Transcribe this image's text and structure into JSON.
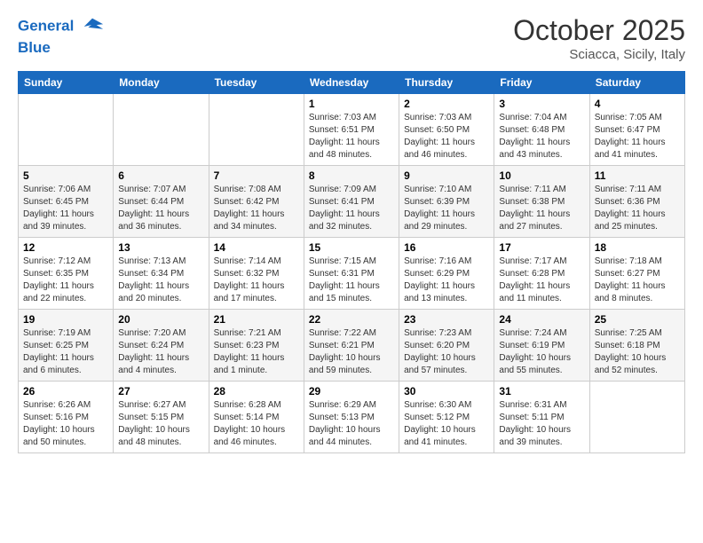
{
  "header": {
    "logo_line1": "General",
    "logo_line2": "Blue",
    "month_title": "October 2025",
    "location": "Sciacca, Sicily, Italy"
  },
  "days_of_week": [
    "Sunday",
    "Monday",
    "Tuesday",
    "Wednesday",
    "Thursday",
    "Friday",
    "Saturday"
  ],
  "weeks": [
    [
      {
        "day": "",
        "info": ""
      },
      {
        "day": "",
        "info": ""
      },
      {
        "day": "",
        "info": ""
      },
      {
        "day": "1",
        "info": "Sunrise: 7:03 AM\nSunset: 6:51 PM\nDaylight: 11 hours\nand 48 minutes."
      },
      {
        "day": "2",
        "info": "Sunrise: 7:03 AM\nSunset: 6:50 PM\nDaylight: 11 hours\nand 46 minutes."
      },
      {
        "day": "3",
        "info": "Sunrise: 7:04 AM\nSunset: 6:48 PM\nDaylight: 11 hours\nand 43 minutes."
      },
      {
        "day": "4",
        "info": "Sunrise: 7:05 AM\nSunset: 6:47 PM\nDaylight: 11 hours\nand 41 minutes."
      }
    ],
    [
      {
        "day": "5",
        "info": "Sunrise: 7:06 AM\nSunset: 6:45 PM\nDaylight: 11 hours\nand 39 minutes."
      },
      {
        "day": "6",
        "info": "Sunrise: 7:07 AM\nSunset: 6:44 PM\nDaylight: 11 hours\nand 36 minutes."
      },
      {
        "day": "7",
        "info": "Sunrise: 7:08 AM\nSunset: 6:42 PM\nDaylight: 11 hours\nand 34 minutes."
      },
      {
        "day": "8",
        "info": "Sunrise: 7:09 AM\nSunset: 6:41 PM\nDaylight: 11 hours\nand 32 minutes."
      },
      {
        "day": "9",
        "info": "Sunrise: 7:10 AM\nSunset: 6:39 PM\nDaylight: 11 hours\nand 29 minutes."
      },
      {
        "day": "10",
        "info": "Sunrise: 7:11 AM\nSunset: 6:38 PM\nDaylight: 11 hours\nand 27 minutes."
      },
      {
        "day": "11",
        "info": "Sunrise: 7:11 AM\nSunset: 6:36 PM\nDaylight: 11 hours\nand 25 minutes."
      }
    ],
    [
      {
        "day": "12",
        "info": "Sunrise: 7:12 AM\nSunset: 6:35 PM\nDaylight: 11 hours\nand 22 minutes."
      },
      {
        "day": "13",
        "info": "Sunrise: 7:13 AM\nSunset: 6:34 PM\nDaylight: 11 hours\nand 20 minutes."
      },
      {
        "day": "14",
        "info": "Sunrise: 7:14 AM\nSunset: 6:32 PM\nDaylight: 11 hours\nand 17 minutes."
      },
      {
        "day": "15",
        "info": "Sunrise: 7:15 AM\nSunset: 6:31 PM\nDaylight: 11 hours\nand 15 minutes."
      },
      {
        "day": "16",
        "info": "Sunrise: 7:16 AM\nSunset: 6:29 PM\nDaylight: 11 hours\nand 13 minutes."
      },
      {
        "day": "17",
        "info": "Sunrise: 7:17 AM\nSunset: 6:28 PM\nDaylight: 11 hours\nand 11 minutes."
      },
      {
        "day": "18",
        "info": "Sunrise: 7:18 AM\nSunset: 6:27 PM\nDaylight: 11 hours\nand 8 minutes."
      }
    ],
    [
      {
        "day": "19",
        "info": "Sunrise: 7:19 AM\nSunset: 6:25 PM\nDaylight: 11 hours\nand 6 minutes."
      },
      {
        "day": "20",
        "info": "Sunrise: 7:20 AM\nSunset: 6:24 PM\nDaylight: 11 hours\nand 4 minutes."
      },
      {
        "day": "21",
        "info": "Sunrise: 7:21 AM\nSunset: 6:23 PM\nDaylight: 11 hours\nand 1 minute."
      },
      {
        "day": "22",
        "info": "Sunrise: 7:22 AM\nSunset: 6:21 PM\nDaylight: 10 hours\nand 59 minutes."
      },
      {
        "day": "23",
        "info": "Sunrise: 7:23 AM\nSunset: 6:20 PM\nDaylight: 10 hours\nand 57 minutes."
      },
      {
        "day": "24",
        "info": "Sunrise: 7:24 AM\nSunset: 6:19 PM\nDaylight: 10 hours\nand 55 minutes."
      },
      {
        "day": "25",
        "info": "Sunrise: 7:25 AM\nSunset: 6:18 PM\nDaylight: 10 hours\nand 52 minutes."
      }
    ],
    [
      {
        "day": "26",
        "info": "Sunrise: 6:26 AM\nSunset: 5:16 PM\nDaylight: 10 hours\nand 50 minutes."
      },
      {
        "day": "27",
        "info": "Sunrise: 6:27 AM\nSunset: 5:15 PM\nDaylight: 10 hours\nand 48 minutes."
      },
      {
        "day": "28",
        "info": "Sunrise: 6:28 AM\nSunset: 5:14 PM\nDaylight: 10 hours\nand 46 minutes."
      },
      {
        "day": "29",
        "info": "Sunrise: 6:29 AM\nSunset: 5:13 PM\nDaylight: 10 hours\nand 44 minutes."
      },
      {
        "day": "30",
        "info": "Sunrise: 6:30 AM\nSunset: 5:12 PM\nDaylight: 10 hours\nand 41 minutes."
      },
      {
        "day": "31",
        "info": "Sunrise: 6:31 AM\nSunset: 5:11 PM\nDaylight: 10 hours\nand 39 minutes."
      },
      {
        "day": "",
        "info": ""
      }
    ]
  ]
}
